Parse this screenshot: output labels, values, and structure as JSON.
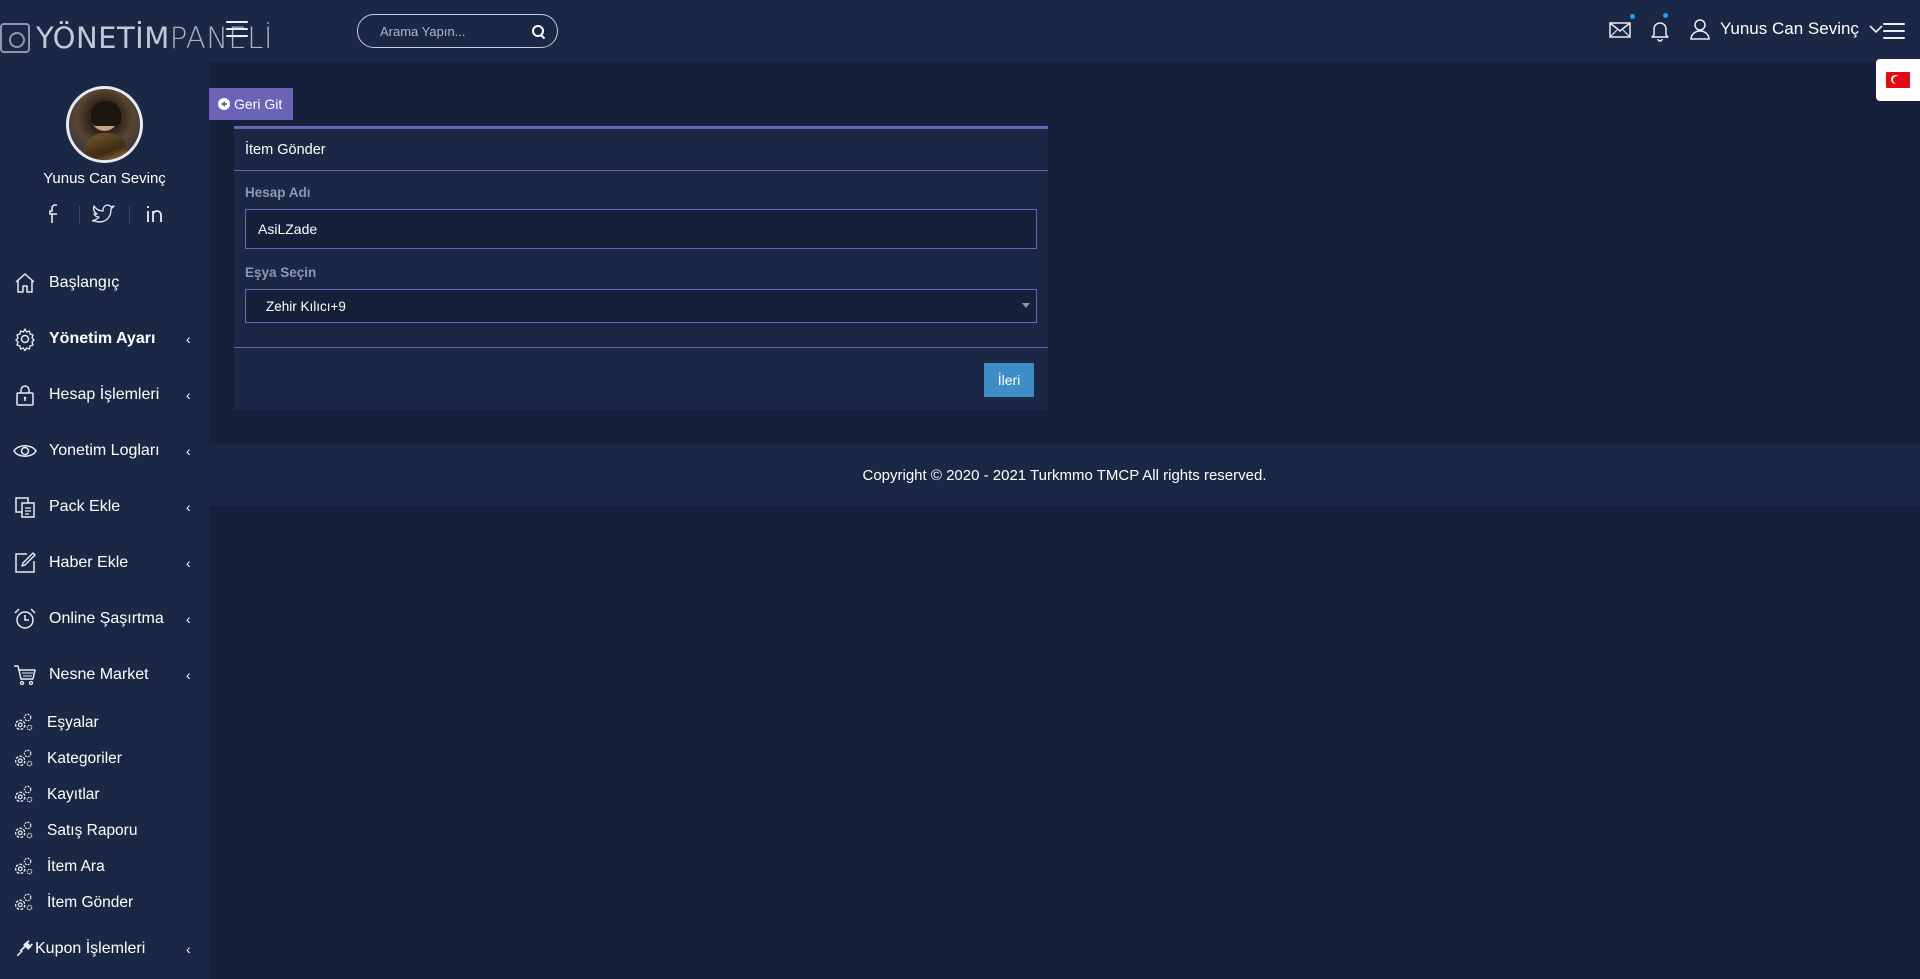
{
  "header": {
    "logo_bold": "YÖNETİM",
    "logo_light": "PANELİ",
    "search_placeholder": "Arama Yapın...",
    "user_name": "Yunus Can Sevinç"
  },
  "sidebar": {
    "profile_name": "Yunus Can Sevinç",
    "menu": [
      {
        "label": "Başlangıç",
        "icon": "home-icon",
        "has_submenu": false,
        "bold": false
      },
      {
        "label": "Yönetim Ayarı",
        "icon": "gear-icon",
        "has_submenu": true,
        "bold": true
      },
      {
        "label": "Hesap İşlemleri",
        "icon": "lock-icon",
        "has_submenu": true,
        "bold": false
      },
      {
        "label": "Yonetim Logları",
        "icon": "eye-icon",
        "has_submenu": true,
        "bold": false
      },
      {
        "label": "Pack Ekle",
        "icon": "copy-icon",
        "has_submenu": true,
        "bold": false
      },
      {
        "label": "Haber Ekle",
        "icon": "edit-icon",
        "has_submenu": true,
        "bold": false
      },
      {
        "label": "Online Şaşırtma",
        "icon": "alarm-clock-icon",
        "has_submenu": true,
        "bold": false
      },
      {
        "label": "Nesne Market",
        "icon": "cart-icon",
        "has_submenu": true,
        "bold": false
      }
    ],
    "submenu": [
      {
        "label": "Eşyalar"
      },
      {
        "label": "Kategoriler"
      },
      {
        "label": "Kayıtlar"
      },
      {
        "label": "Satış Raporu"
      },
      {
        "label": "İtem Ara"
      },
      {
        "label": "İtem Gönder"
      }
    ],
    "last_item": {
      "label": "Kupon İşlemleri",
      "icon": "plug-icon"
    },
    "chevron": "‹"
  },
  "main": {
    "back_label": "Geri Git",
    "card_title": "İtem Gönder",
    "account_label": "Hesap Adı",
    "account_value": "AsiLZade",
    "item_label": "Eşya Seçin",
    "item_selected": "Zehir Kılıcı+9",
    "next_label": "İleri"
  },
  "footer": {
    "copyright": "Copyright © 2020 - 2021 Turkmmo TMCP All rights reserved."
  },
  "colors": {
    "background": "#16203a",
    "panel": "#1b2845",
    "accent": "#6a63b6",
    "button_blue": "#3f8dc7",
    "notification_dot": "#1da1f2",
    "flag_red": "#e30a17"
  }
}
